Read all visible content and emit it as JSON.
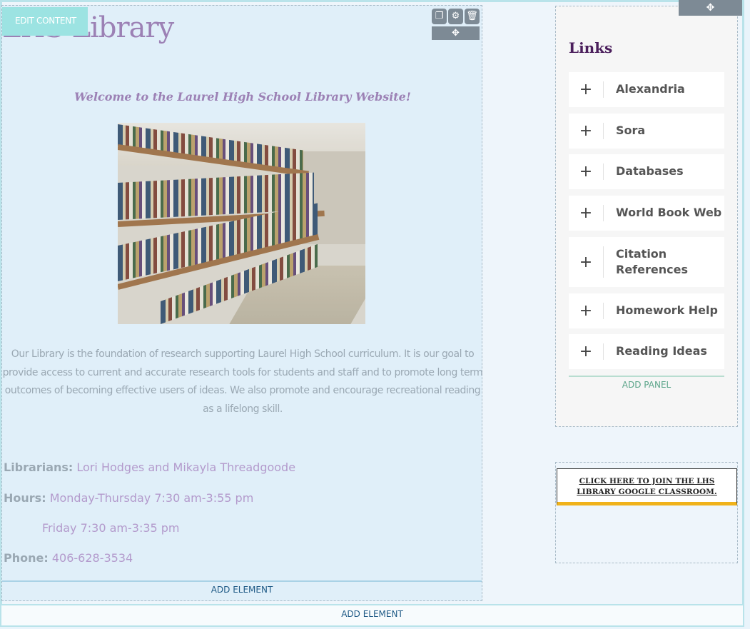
{
  "toolbar": {
    "edit_content": "EDIT CONTENT",
    "move_icon": "move-icon",
    "copy_icon": "copy-icon",
    "gear_icon": "gear-icon",
    "trash_icon": "trash-icon"
  },
  "main": {
    "site_title": "LHS Library",
    "welcome": "Welcome to the Laurel High School Library Website!",
    "photo_alt": "Library bookshelves",
    "description": "Our Library is the foundation of research supporting Laurel High School curriculum.  It is our goal to provide access to current and accurate research tools for students and staff and to promote long term outcomes of becoming effective users of ideas.  We also promote and encourage recreational reading as a lifelong skill.",
    "librarians_label": "Librarians:",
    "librarians_value": "Lori Hodges and Mikayla Threadgoode",
    "hours_label": "Hours:",
    "hours_value": "Monday-Thursday 7:30 am-3:55 pm",
    "friday_value": "Friday 7:30 am-3:35 pm",
    "phone_label": "Phone:",
    "phone_value": "406-628-3534",
    "add_element": "ADD ELEMENT"
  },
  "sidebar": {
    "links_title": "Links",
    "items": [
      {
        "label": "Alexandria"
      },
      {
        "label": "Sora"
      },
      {
        "label": "Databases"
      },
      {
        "label": "World Book Web"
      },
      {
        "label": "Citation References"
      },
      {
        "label": "Homework Help"
      },
      {
        "label": "Reading Ideas"
      }
    ],
    "add_panel": "ADD PANEL",
    "cta_line1": "CLICK HERE TO JOIN THE LHS",
    "cta_line2": "LIBRARY GOOGLE CLASSROOM."
  },
  "footer": {
    "add_element": "ADD ELEMENT"
  },
  "colors": {
    "accent_purple": "#9c81b5",
    "links_title": "#4b1f5c",
    "edit_button": "#9ce3e2",
    "cta_underline": "#f0b21a"
  }
}
